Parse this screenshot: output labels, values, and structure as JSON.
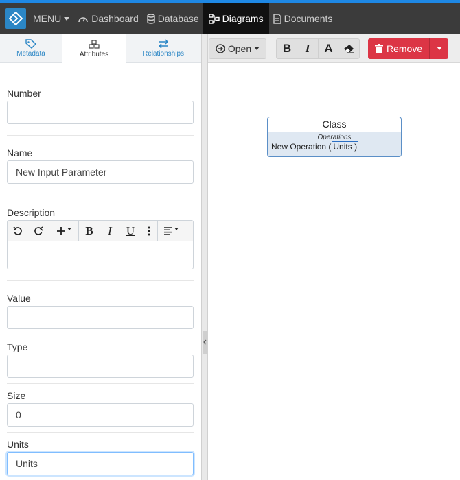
{
  "navbar": {
    "menu_label": "MENU",
    "items": [
      {
        "label": "Dashboard",
        "icon": "gauge-icon"
      },
      {
        "label": "Database",
        "icon": "database-icon"
      },
      {
        "label": "Diagrams",
        "icon": "sitemap-icon",
        "active": true
      },
      {
        "label": "Documents",
        "icon": "file-icon"
      }
    ],
    "accent_color": "#1e88e5",
    "bg_color": "#3b3b3b"
  },
  "left_panel": {
    "tabs": [
      {
        "label": "Metadata",
        "icon": "tag-icon"
      },
      {
        "label": "Attributes",
        "icon": "cubes-icon",
        "active": true
      },
      {
        "label": "Relationships",
        "icon": "exchange-icon"
      }
    ],
    "fields": {
      "number": {
        "label": "Number",
        "value": ""
      },
      "name": {
        "label": "Name",
        "value": "New Input Parameter"
      },
      "description": {
        "label": "Description",
        "value": ""
      },
      "value": {
        "label": "Value",
        "value": ""
      },
      "type": {
        "label": "Type",
        "value": ""
      },
      "size": {
        "label": "Size",
        "value": "0"
      },
      "units": {
        "label": "Units",
        "value": "Units"
      }
    }
  },
  "toolbar": {
    "open_label": "Open",
    "remove_label": "Remove",
    "remove_color": "#dc3545"
  },
  "diagram": {
    "class_title": "Class",
    "section_label": "Operations",
    "operation_prefix": "New Operation (",
    "operation_param": "Units",
    "operation_suffix": ")"
  }
}
